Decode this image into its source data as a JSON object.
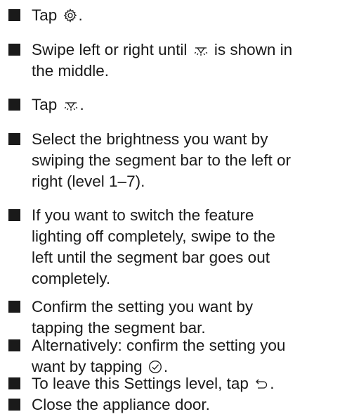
{
  "steps": [
    {
      "before": "Tap ",
      "icon": "gear-icon",
      "after": "."
    },
    {
      "before": "Swipe left or right until ",
      "icon": "feature-lighting-icon",
      "after": " is shown in\nthe middle."
    },
    {
      "before": "Tap ",
      "icon": "feature-lighting-icon",
      "after": "."
    },
    {
      "before": "Select the brightness you want by\nswiping the segment bar to the left or\nright (level 1–7).",
      "icon": "",
      "after": ""
    },
    {
      "before": "If you want to switch the feature\nlighting off completely, swipe to the\nleft until the segment bar goes out\ncompletely.",
      "icon": "",
      "after": ""
    },
    {
      "before": "Confirm the setting you want by\ntapping the segment bar.",
      "icon": "",
      "after": ""
    },
    {
      "before": "Alternatively: confirm the setting you\nwant by tapping ",
      "icon": "check-circle-icon",
      "after": "."
    },
    {
      "before": "To leave this Settings level, tap ",
      "icon": "back-arrow-icon",
      "after": "."
    },
    {
      "before": "Close the appliance door.",
      "icon": "",
      "after": ""
    }
  ]
}
